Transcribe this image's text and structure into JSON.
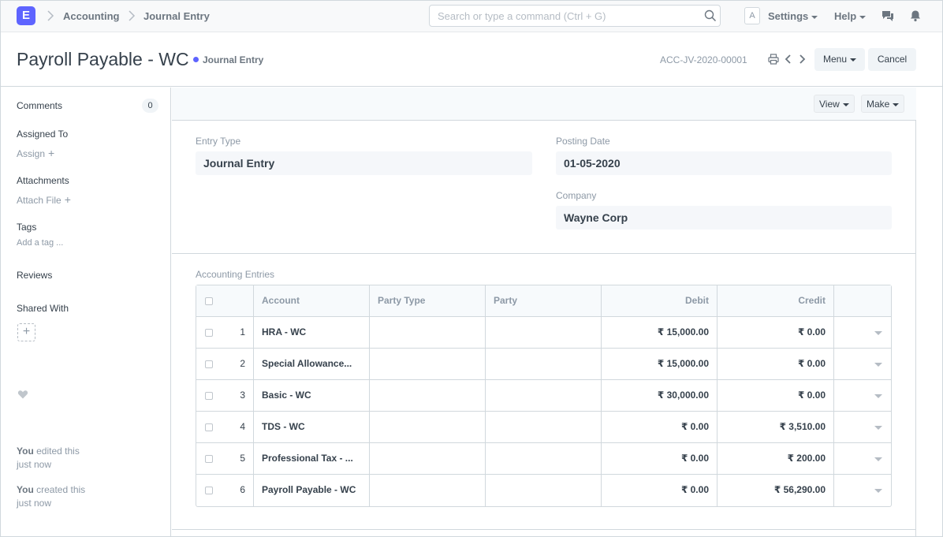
{
  "navbar": {
    "logo": "E",
    "breadcrumbs": [
      "Accounting",
      "Journal Entry"
    ],
    "search_placeholder": "Search or type a command (Ctrl + G)",
    "avatar": "A",
    "settings": "Settings",
    "help": "Help"
  },
  "header": {
    "title": "Payroll Payable - WC",
    "status": "Journal Entry",
    "doc_name": "ACC-JV-2020-00001",
    "menu": "Menu",
    "cancel": "Cancel",
    "colors": {
      "accent": "#5e64ff"
    }
  },
  "sidebar": {
    "comments": "Comments",
    "comments_count": "0",
    "assigned_to": "Assigned To",
    "assign": "Assign",
    "attachments": "Attachments",
    "attach_file": "Attach File",
    "tags": "Tags",
    "add_tag": "Add a tag ...",
    "reviews": "Reviews",
    "shared_with": "Shared With",
    "activity": [
      {
        "who": "You",
        "action": "edited this",
        "when": "just now"
      },
      {
        "who": "You",
        "action": "created this",
        "when": "just now"
      }
    ]
  },
  "toolbar": {
    "view": "View",
    "make": "Make"
  },
  "form": {
    "entry_type_label": "Entry Type",
    "entry_type": "Journal Entry",
    "posting_date_label": "Posting Date",
    "posting_date": "01-05-2020",
    "company_label": "Company",
    "company": "Wayne Corp"
  },
  "accounting_entries": {
    "label": "Accounting Entries",
    "columns": [
      "Account",
      "Party Type",
      "Party",
      "Debit",
      "Credit"
    ],
    "rows": [
      {
        "idx": "1",
        "account": "HRA - WC",
        "party_type": "",
        "party": "",
        "debit": "₹ 15,000.00",
        "credit": "₹ 0.00"
      },
      {
        "idx": "2",
        "account": "Special Allowance...",
        "party_type": "",
        "party": "",
        "debit": "₹ 15,000.00",
        "credit": "₹ 0.00"
      },
      {
        "idx": "3",
        "account": "Basic - WC",
        "party_type": "",
        "party": "",
        "debit": "₹ 30,000.00",
        "credit": "₹ 0.00"
      },
      {
        "idx": "4",
        "account": "TDS - WC",
        "party_type": "",
        "party": "",
        "debit": "₹ 0.00",
        "credit": "₹ 3,510.00"
      },
      {
        "idx": "5",
        "account": "Professional Tax - ...",
        "party_type": "",
        "party": "",
        "debit": "₹ 0.00",
        "credit": "₹ 200.00"
      },
      {
        "idx": "6",
        "account": "Payroll Payable - WC",
        "party_type": "",
        "party": "",
        "debit": "₹ 0.00",
        "credit": "₹ 56,290.00"
      }
    ]
  }
}
